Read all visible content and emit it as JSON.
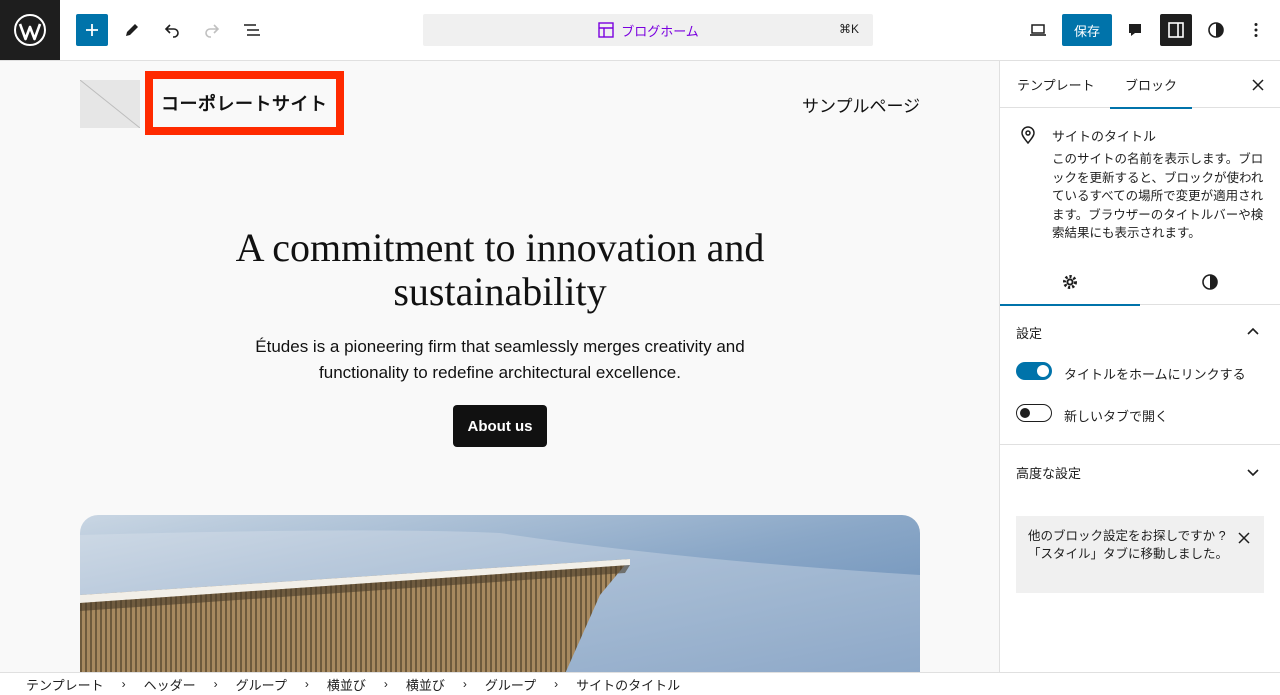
{
  "toolbar": {
    "command_label": "ブログホーム",
    "command_shortcut": "⌘K",
    "save_label": "保存",
    "accent": "#0073aa"
  },
  "canvas": {
    "site_title": "コーポレートサイト",
    "nav_link": "サンプルページ",
    "hero_heading": "A commitment to innovation and sustainability",
    "hero_text": "Études is a pioneering firm that seamlessly merges creativity and functionality to redefine architectural excellence.",
    "cta_label": "About us",
    "highlight_color": "#ff2a00"
  },
  "sidebar": {
    "tabs": [
      {
        "label": "テンプレート"
      },
      {
        "label": "ブロック"
      }
    ],
    "block": {
      "name": "サイトのタイトル",
      "description": "このサイトの名前を表示します。ブロックを更新すると、ブロックが使われているすべての場所で変更が適用されます。ブラウザーのタイトルバーや検索結果にも表示されます。"
    },
    "settings_panel": {
      "title": "設定",
      "options": [
        {
          "label": "タイトルをホームにリンクする",
          "enabled": true
        },
        {
          "label": "新しいタブで開く",
          "enabled": false
        }
      ]
    },
    "advanced_panel": {
      "title": "高度な設定"
    },
    "notice": "他のブロック設定をお探しですか ?「スタイル」タブに移動しました。"
  },
  "breadcrumb": [
    "テンプレート",
    "ヘッダー",
    "グループ",
    "横並び",
    "横並び",
    "グループ",
    "サイトのタイトル"
  ]
}
